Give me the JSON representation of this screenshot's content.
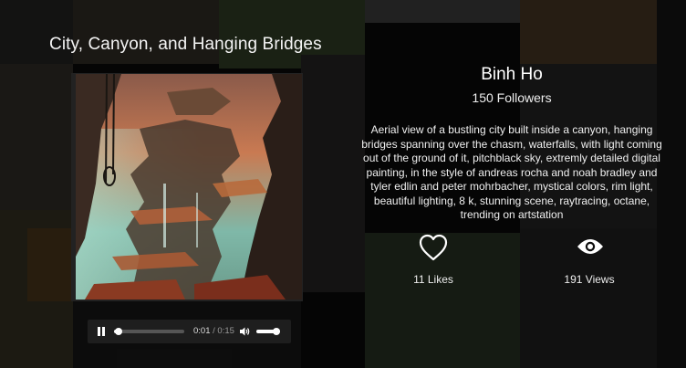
{
  "post": {
    "title": "City, Canyon, and Hanging Bridges",
    "author": "Binh Ho",
    "followers": "150 Followers",
    "description": "Aerial view of a bustling city built inside a canyon, hanging bridges spanning over the chasm, waterfalls, with light coming out of the ground of it, pitchblack sky, extremly detailed digital painting, in the style of andreas rocha and noah bradley and tyler edlin and peter mohrbacher, mystical colors, rim light, beautiful lighting, 8 k, stunning scene, raytracing, octane, trending on artstation",
    "likes": "11 Likes",
    "views": "191 Views"
  },
  "player": {
    "current_time": "0:01",
    "separator": "/",
    "duration": "0:15",
    "progress_fraction": 0.07,
    "volume_fraction": 1.0
  },
  "icons": {
    "play_pause": "pause-icon",
    "volume": "volume-icon",
    "like": "heart-icon",
    "views": "eye-icon"
  },
  "colors": {
    "background": "#0d0d0d",
    "text": "#ffffff",
    "player_bg": "#1e1e1e"
  }
}
